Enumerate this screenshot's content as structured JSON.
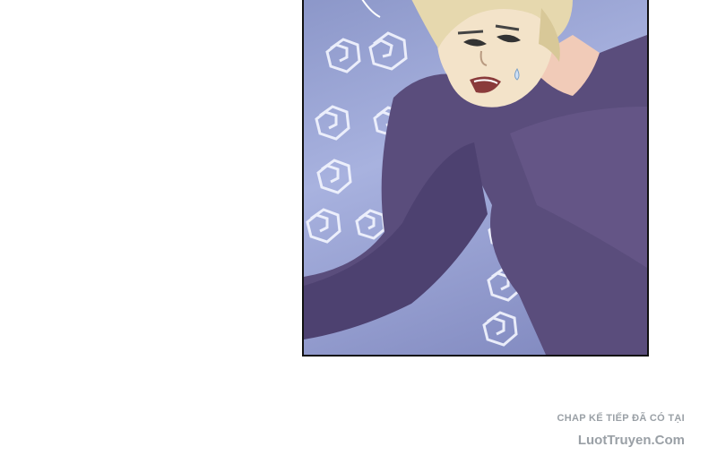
{
  "colors": {
    "background": "#ffffff",
    "panel_border": "#111111",
    "shirt": "#5a4d7c",
    "skin": "#f3e3c9",
    "hair": "#e6d8ae",
    "swirl": "#f4f6ff",
    "credit_text": "#9aa0a6"
  },
  "watermark": {
    "line1": "CHAP KẾ TIẾP ĐÃ CÓ TẠI",
    "line2": "LuotTruyen.Com"
  }
}
